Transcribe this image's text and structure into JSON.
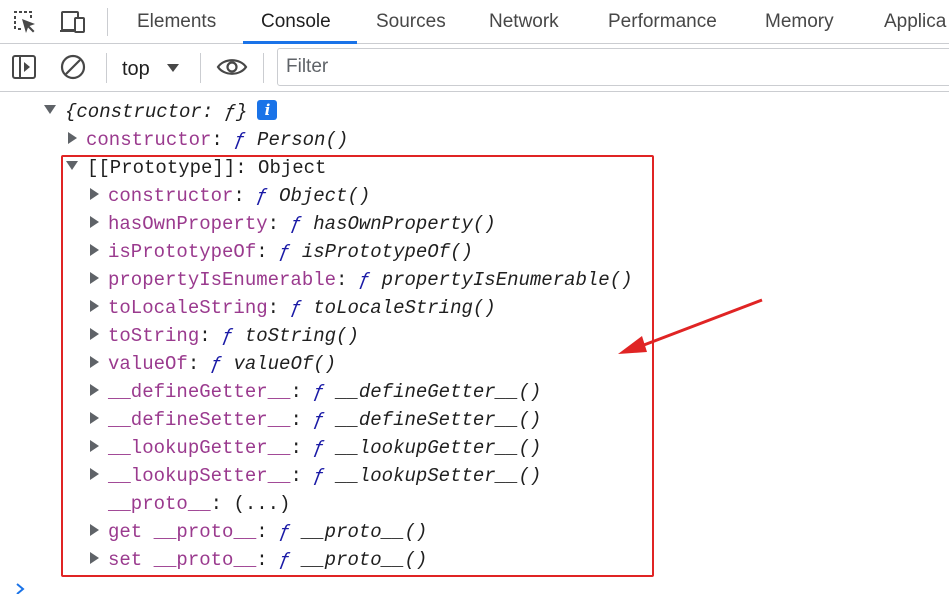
{
  "tabs": [
    {
      "label": "Elements"
    },
    {
      "label": "Console"
    },
    {
      "label": "Sources"
    },
    {
      "label": "Network"
    },
    {
      "label": "Performance"
    },
    {
      "label": "Memory"
    },
    {
      "label": "Applica"
    }
  ],
  "toolbar": {
    "context": "top",
    "filter_placeholder": "Filter"
  },
  "tree": {
    "root_label": "{constructor: ƒ}",
    "root_badge": "i",
    "constructor_row": {
      "key": "constructor",
      "fn": "ƒ",
      "name": "Person()"
    },
    "prototype_row": {
      "key": "[[Prototype]]",
      "value": "Object"
    },
    "prototype_items": [
      {
        "key": "constructor",
        "fn": "ƒ",
        "name": "Object()"
      },
      {
        "key": "hasOwnProperty",
        "fn": "ƒ",
        "name": "hasOwnProperty()"
      },
      {
        "key": "isPrototypeOf",
        "fn": "ƒ",
        "name": "isPrototypeOf()"
      },
      {
        "key": "propertyIsEnumerable",
        "fn": "ƒ",
        "name": "propertyIsEnumerable()"
      },
      {
        "key": "toLocaleString",
        "fn": "ƒ",
        "name": "toLocaleString()"
      },
      {
        "key": "toString",
        "fn": "ƒ",
        "name": "toString()"
      },
      {
        "key": "valueOf",
        "fn": "ƒ",
        "name": "valueOf()"
      },
      {
        "key": "__defineGetter__",
        "fn": "ƒ",
        "name": "__defineGetter__()"
      },
      {
        "key": "__defineSetter__",
        "fn": "ƒ",
        "name": "__defineSetter__()"
      },
      {
        "key": "__lookupGetter__",
        "fn": "ƒ",
        "name": "__lookupGetter__()"
      },
      {
        "key": "__lookupSetter__",
        "fn": "ƒ",
        "name": "__lookupSetter__()"
      }
    ],
    "proto_row": {
      "key": "__proto__",
      "value": "(...)"
    },
    "getset_rows": [
      {
        "prefix": "get",
        "key": "__proto__",
        "fn": "ƒ",
        "name": "__proto__()"
      },
      {
        "prefix": "set",
        "key": "__proto__",
        "fn": "ƒ",
        "name": "__proto__()"
      }
    ]
  },
  "colors": {
    "annotation_red": "#e02424",
    "key_purple": "#9a3a8e",
    "fn_blue": "#1a1aa6",
    "tab_underline": "#1a73e8"
  }
}
